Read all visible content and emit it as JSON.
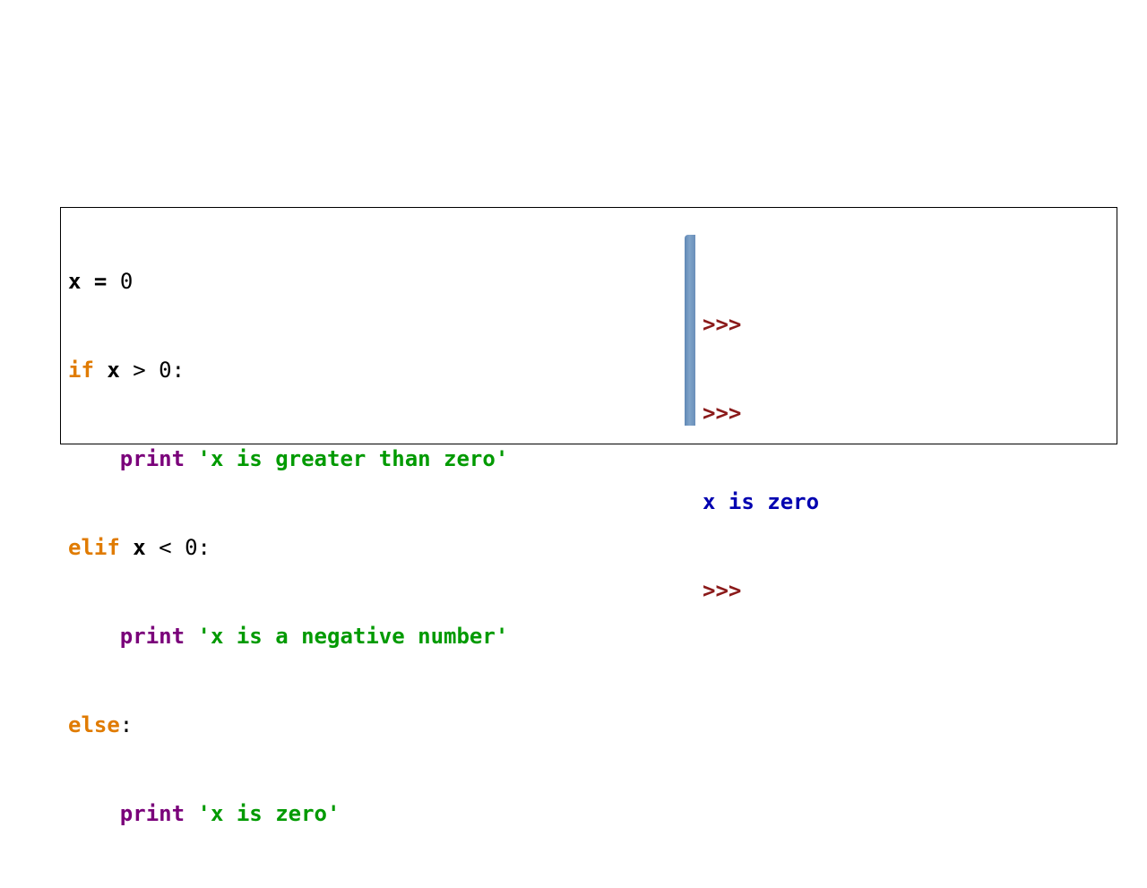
{
  "colors": {
    "keyword": "#e07b00",
    "identifier": "#000000",
    "builtin": "#7a007a",
    "string": "#009a00",
    "prompt": "#8b1a1a",
    "output": "#0000b0"
  },
  "code": {
    "line1": {
      "var": "x",
      "op": "=",
      "num": "0"
    },
    "line2": {
      "kw": "if",
      "var": "x",
      "op": ">",
      "num": "0",
      "colon": ":"
    },
    "line3": {
      "fn": "print",
      "str": "'x is greater than zero'"
    },
    "line4": {
      "kw": "elif",
      "var": "x",
      "op": "<",
      "num": "0",
      "colon": ":"
    },
    "line5": {
      "fn": "print",
      "str": "'x is a negative number'"
    },
    "line6": {
      "kw": "else",
      "colon": ":"
    },
    "line7": {
      "fn": "print",
      "str": "'x is zero'"
    }
  },
  "console": {
    "prompt1": ">>>",
    "prompt2": ">>>",
    "output": "x is zero",
    "prompt3": ">>>"
  }
}
